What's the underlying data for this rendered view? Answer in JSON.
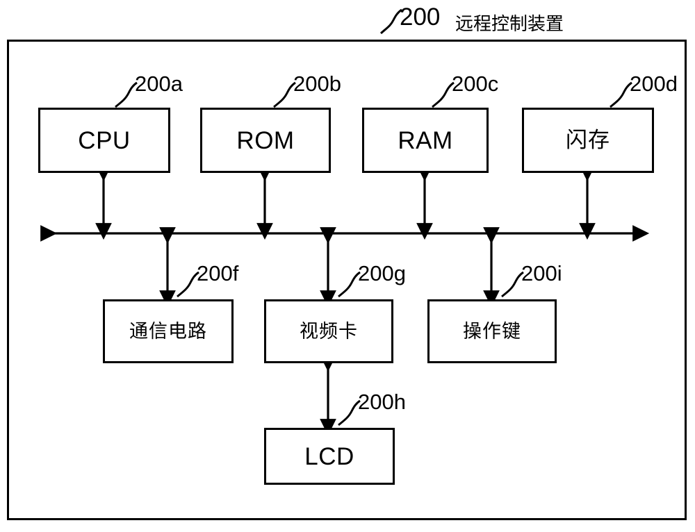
{
  "figure": {
    "main_ref": "200",
    "main_title": "远程控制装置",
    "blocks": [
      {
        "id": "cpu",
        "label": "CPU",
        "ref": "200a",
        "script": "lat"
      },
      {
        "id": "rom",
        "label": "ROM",
        "ref": "200b",
        "script": "lat"
      },
      {
        "id": "ram",
        "label": "RAM",
        "ref": "200c",
        "script": "lat"
      },
      {
        "id": "flash",
        "label": "闪存",
        "ref": "200d",
        "script": "cjk"
      },
      {
        "id": "comm",
        "label": "通信电路",
        "ref": "200f",
        "script": "cjk"
      },
      {
        "id": "video",
        "label": "视频卡",
        "ref": "200g",
        "script": "cjk"
      },
      {
        "id": "keys",
        "label": "操作键",
        "ref": "200i",
        "script": "cjk"
      },
      {
        "id": "lcd",
        "label": "LCD",
        "ref": "200h",
        "script": "lat"
      }
    ],
    "bus": {
      "name": "system-bus",
      "double_ended": true
    },
    "connections": [
      {
        "from": "cpu",
        "to": "bus",
        "arrows": "both"
      },
      {
        "from": "rom",
        "to": "bus",
        "arrows": "both"
      },
      {
        "from": "ram",
        "to": "bus",
        "arrows": "both"
      },
      {
        "from": "flash",
        "to": "bus",
        "arrows": "both"
      },
      {
        "from": "bus",
        "to": "comm",
        "arrows": "both"
      },
      {
        "from": "bus",
        "to": "video",
        "arrows": "both"
      },
      {
        "from": "bus",
        "to": "keys",
        "arrows": "both"
      },
      {
        "from": "video",
        "to": "lcd",
        "arrows": "both"
      }
    ]
  }
}
